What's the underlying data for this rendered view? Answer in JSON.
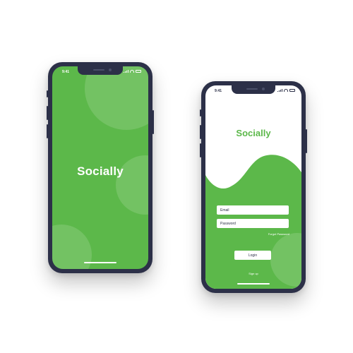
{
  "app_name": "Socially",
  "brand_color": "#5cb84a",
  "frame_color": "#2c3048",
  "splash_screen": {
    "status_time": "9:41",
    "title": "Socially"
  },
  "login_screen": {
    "status_time": "9:41",
    "title": "Socially",
    "email_placeholder": "Email",
    "password_placeholder": "Password",
    "forgot_password_label": "Forgot Password",
    "login_label": "Login",
    "signup_label": "Sign up"
  },
  "status_icons": [
    "signal-icon",
    "wifi-icon",
    "battery-icon"
  ]
}
